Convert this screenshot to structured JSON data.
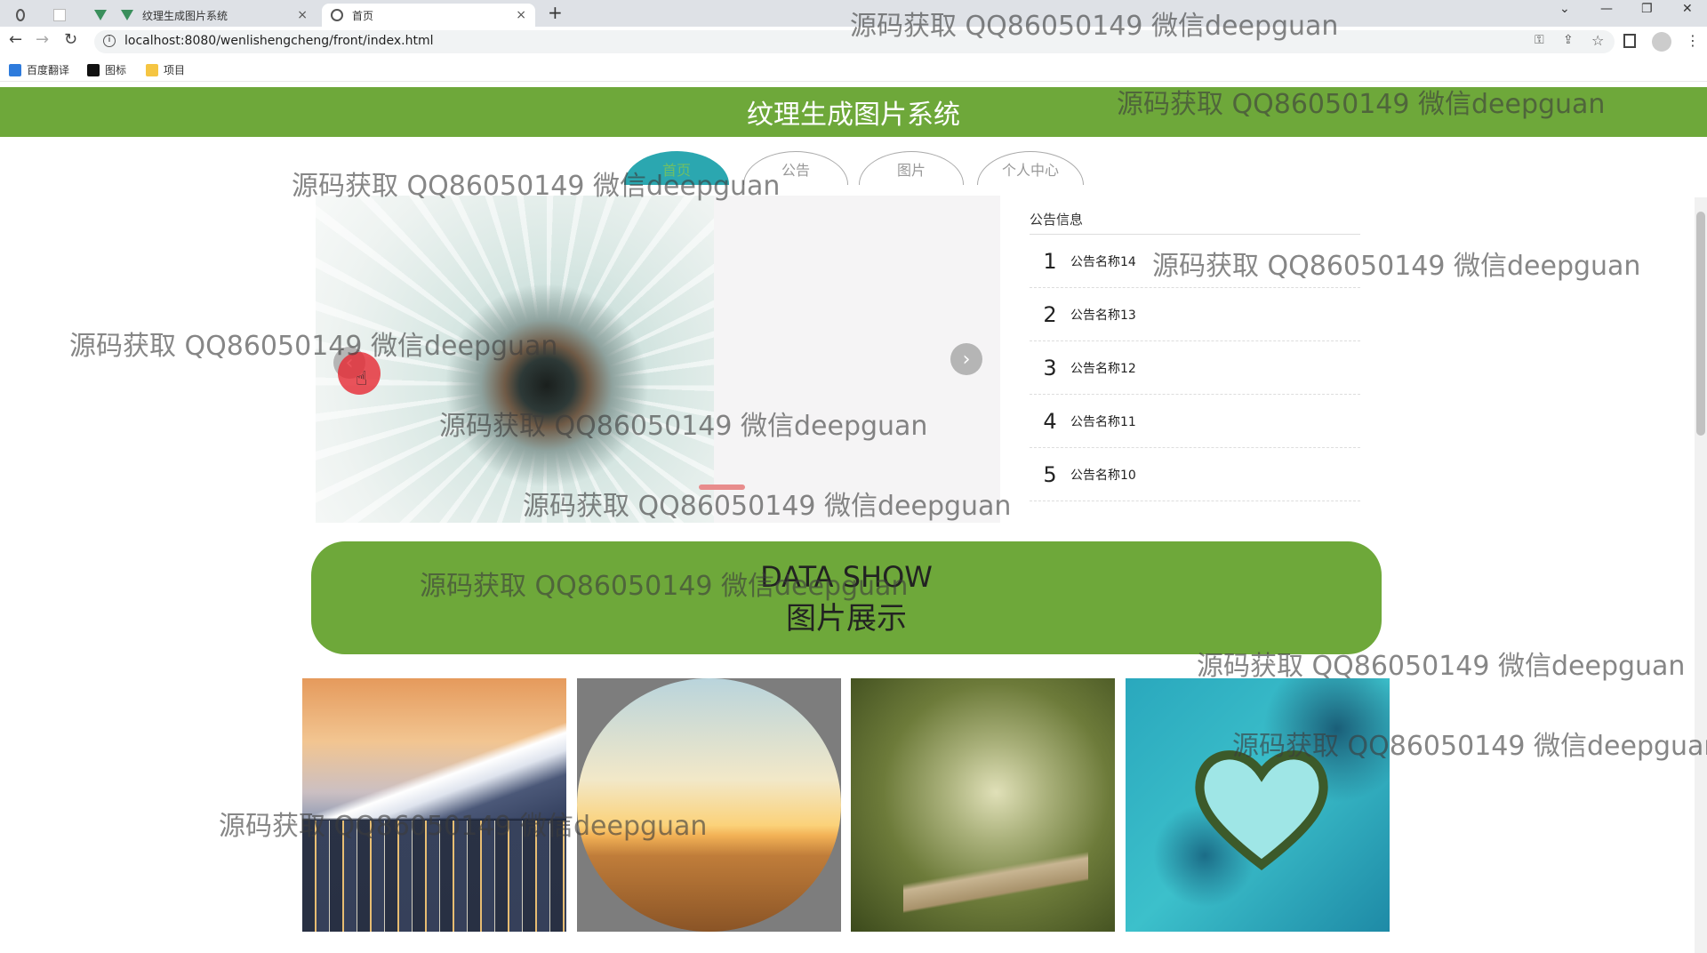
{
  "browser": {
    "tabs": [
      {
        "label": "",
        "active": false
      },
      {
        "label": "纹理生成图片系统",
        "active": false
      },
      {
        "label": "首页",
        "active": true
      }
    ],
    "new_tab_symbol": "+",
    "close_symbol": "×",
    "url": "localhost:8080/wenlishengcheng/front/index.html",
    "bookmarks": [
      "百度翻译",
      "图标",
      "项目"
    ],
    "window_controls": [
      "⌄",
      "—",
      "❐",
      "✕"
    ]
  },
  "site": {
    "title": "纹理生成图片系统",
    "nav": [
      {
        "label": "首页",
        "active": true
      },
      {
        "label": "公告",
        "active": false
      },
      {
        "label": "图片",
        "active": false
      },
      {
        "label": "个人中心",
        "active": false
      }
    ]
  },
  "carousel": {
    "prev_symbol": "‹",
    "next_symbol": "›"
  },
  "notices": {
    "title": "公告信息",
    "items": [
      {
        "num": "1",
        "name": "公告名称14"
      },
      {
        "num": "2",
        "name": "公告名称13"
      },
      {
        "num": "3",
        "name": "公告名称12"
      },
      {
        "num": "4",
        "name": "公告名称11"
      },
      {
        "num": "5",
        "name": "公告名称10"
      }
    ]
  },
  "banner": {
    "en": "DATA SHOW",
    "cn": "图片展示"
  },
  "gallery": {
    "photos": [
      "mountain-city",
      "desert-sunset",
      "forest-road",
      "heart-island"
    ]
  },
  "watermark": "源码获取 QQ86050149 微信deepguan",
  "colors": {
    "header_green": "#6ea83a",
    "nav_active": "#2ba7b0",
    "cursor_red": "#e62832"
  }
}
